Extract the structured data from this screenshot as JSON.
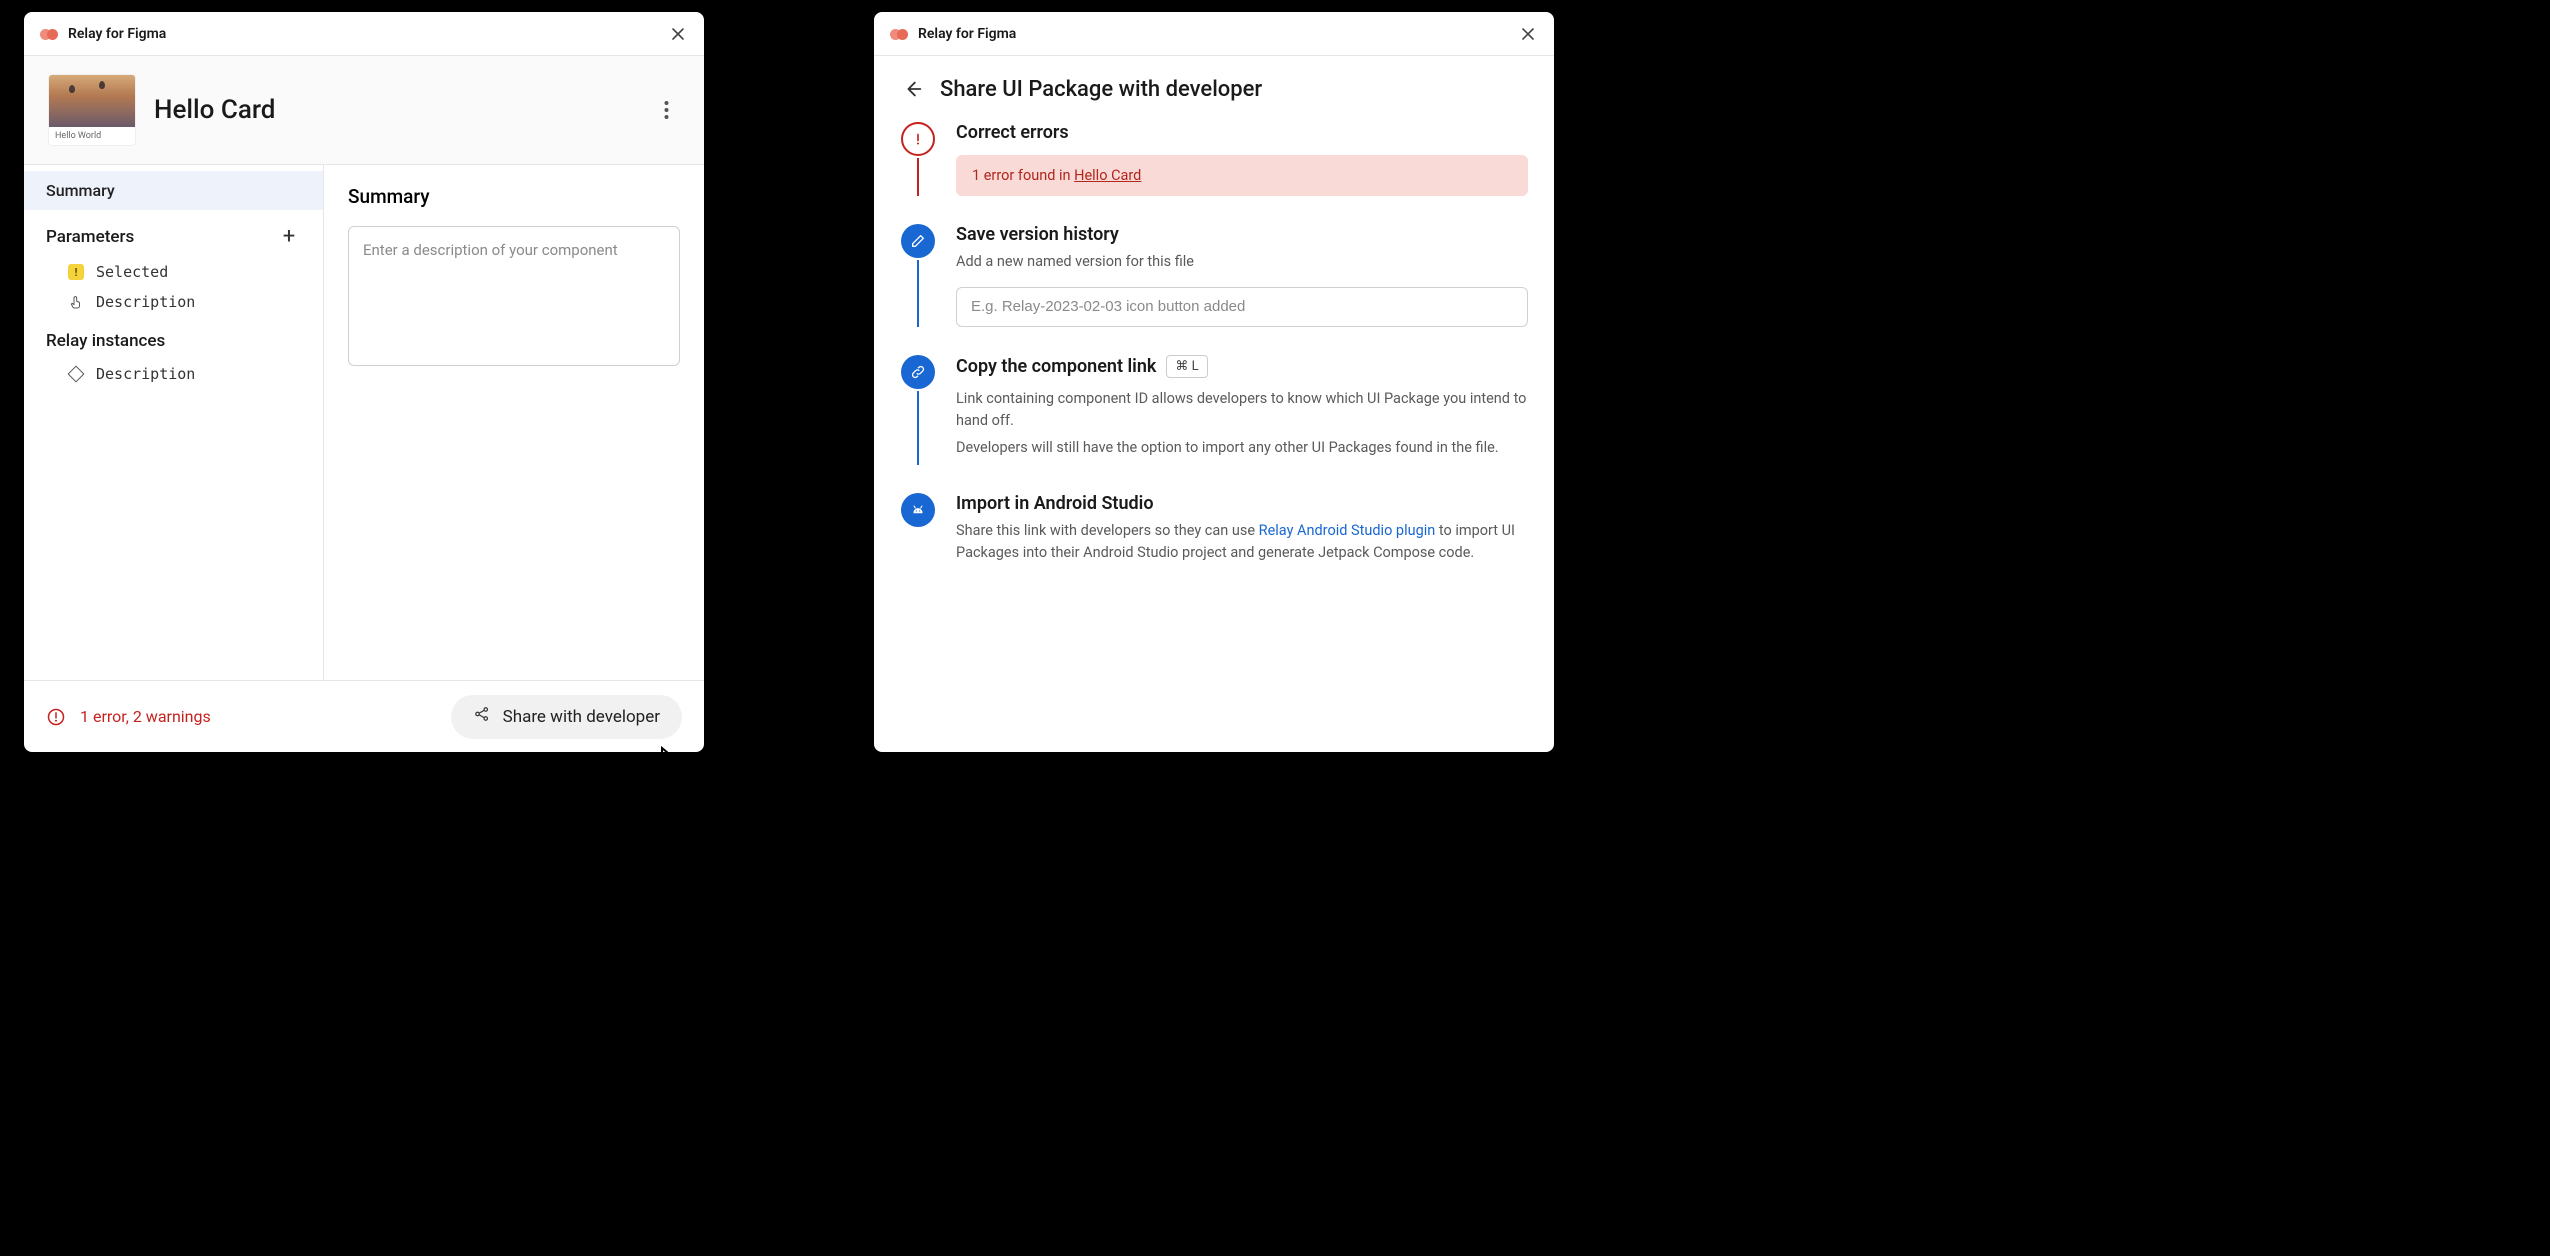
{
  "app_name": "Relay for Figma",
  "left": {
    "package_name": "Hello Card",
    "thumb_caption": "Hello World",
    "sidebar": {
      "summary": "Summary",
      "parameters_head": "Parameters",
      "param_items": [
        "Selected",
        "Description"
      ],
      "relay_head": "Relay instances",
      "relay_items": [
        "Description"
      ]
    },
    "main_title": "Summary",
    "summary_placeholder": "Enter a description of your component",
    "footer_error": "1 error, 2 warnings",
    "share_label": "Share with developer"
  },
  "right": {
    "page_title": "Share UI Package with developer",
    "steps": {
      "correct": {
        "title": "Correct errors",
        "banner_prefix": "1 error found in ",
        "banner_link": "Hello Card"
      },
      "save": {
        "title": "Save version history",
        "sub": "Add a new named version for this file",
        "placeholder": "E.g. Relay-2023-02-03 icon button added"
      },
      "copy": {
        "title": "Copy the component link",
        "kbd": "⌘ L",
        "sub1": "Link containing component ID allows developers to know which UI Package you intend to hand off.",
        "sub2": "Developers will still have the option to import any other UI Packages found in the file."
      },
      "import": {
        "title": "Import in Android Studio",
        "sub_prefix": "Share this link with developers so they can use ",
        "sub_link": "Relay Android Studio plugin",
        "sub_suffix": " to import UI Packages into their Android Studio project and generate Jetpack Compose code."
      }
    }
  }
}
